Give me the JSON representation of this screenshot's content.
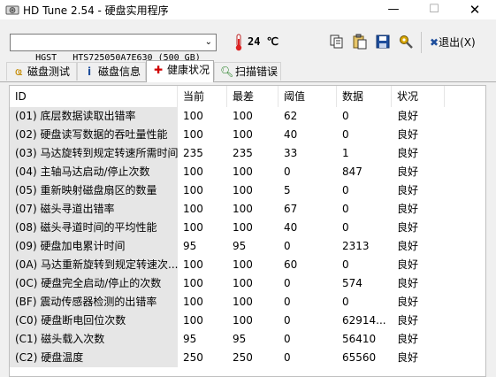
{
  "window": {
    "title": "HD Tune 2.54 - 硬盘实用程序",
    "min": "—",
    "max": "☐",
    "close": "✕"
  },
  "toolbar": {
    "drive": "HGST   HTS725050A7E630 (500 GB)",
    "temperature": "24 ℃",
    "exit_label": "退出(X)",
    "exit_icon_text": "✖"
  },
  "tabs": [
    {
      "label": "磁盘测试",
      "icon": "benchmark-icon"
    },
    {
      "label": "磁盘信息",
      "icon": "info-icon"
    },
    {
      "label": "健康状况",
      "icon": "health-cross-icon",
      "active": true
    },
    {
      "label": "扫描错误",
      "icon": "magnifier-icon"
    }
  ],
  "table": {
    "columns": [
      "ID",
      "当前",
      "最差",
      "阈值",
      "数据",
      "状况"
    ],
    "rows": [
      [
        "(01) 底层数据读取出错率",
        "100",
        "100",
        "62",
        "0",
        "良好"
      ],
      [
        "(02) 硬盘读写数据的吞吐量性能",
        "100",
        "100",
        "40",
        "0",
        "良好"
      ],
      [
        "(03) 马达旋转到规定转速所需时间",
        "235",
        "235",
        "33",
        "1",
        "良好"
      ],
      [
        "(04) 主轴马达启动/停止次数",
        "100",
        "100",
        "0",
        "847",
        "良好"
      ],
      [
        "(05) 重新映射磁盘扇区的数量",
        "100",
        "100",
        "5",
        "0",
        "良好"
      ],
      [
        "(07) 磁头寻道出错率",
        "100",
        "100",
        "67",
        "0",
        "良好"
      ],
      [
        "(08) 磁头寻道时间的平均性能",
        "100",
        "100",
        "40",
        "0",
        "良好"
      ],
      [
        "(09) 硬盘加电累计时间",
        "95",
        "95",
        "0",
        "2313",
        "良好"
      ],
      [
        "(0A) 马达重新旋转到规定转速次...",
        "100",
        "100",
        "60",
        "0",
        "良好"
      ],
      [
        "(0C) 硬盘完全启动/停止的次数",
        "100",
        "100",
        "0",
        "574",
        "良好"
      ],
      [
        "(BF) 震动传感器检测的出错率",
        "100",
        "100",
        "0",
        "0",
        "良好"
      ],
      [
        "(C0) 硬盘断电回位次数",
        "100",
        "100",
        "0",
        "62914...",
        "良好"
      ],
      [
        "(C1) 磁头载入次数",
        "95",
        "95",
        "0",
        "56410",
        "良好"
      ],
      [
        "(C2) 硬盘温度",
        "250",
        "250",
        "0",
        "65560",
        "良好"
      ]
    ]
  }
}
